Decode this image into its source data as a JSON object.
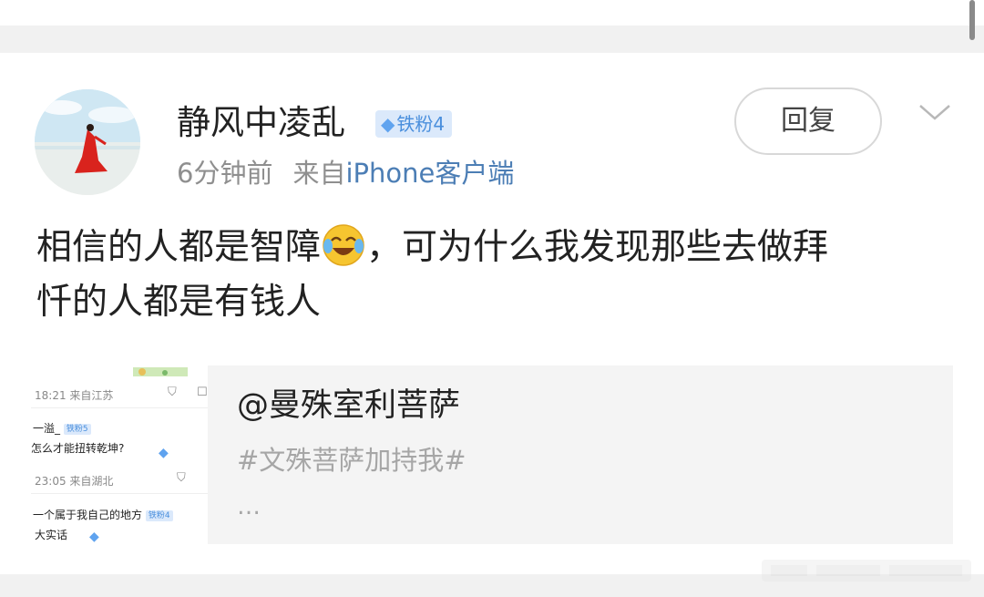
{
  "post": {
    "user": {
      "name": "静风中凌乱",
      "badge_label": "铁粉4"
    },
    "time": "6分钟前",
    "source_prefix": "来自",
    "source": "iPhone客户端",
    "reply_label": "回复",
    "text_line1_before": "相信的人都是智障",
    "text_line1_after": "，可为什么我发现那些去做拜",
    "text_line2": "忏的人都是有钱人",
    "emoji": "laughing-crying-emoji"
  },
  "quote": {
    "title": "@曼殊室利菩萨",
    "hashtag": "#文殊菩萨加持我#",
    "more": "…",
    "thumbnail": {
      "row1_time": "18:21",
      "row1_source": "来自江苏",
      "row2_name": "一溢_",
      "row2_badge": "铁粉5",
      "row3_text": "怎么才能扭转乾坤?",
      "row4_time": "23:05",
      "row4_source": "来自湖北",
      "row5_text": "一个属于我自己的地方",
      "row5_badge": "铁粉4",
      "row6_text": "大实话"
    }
  },
  "colors": {
    "accent_link": "#4c7eb5",
    "badge_bg": "#dbe9fb",
    "badge_text": "#4a8fdd",
    "separator": "#f1f1f1"
  }
}
